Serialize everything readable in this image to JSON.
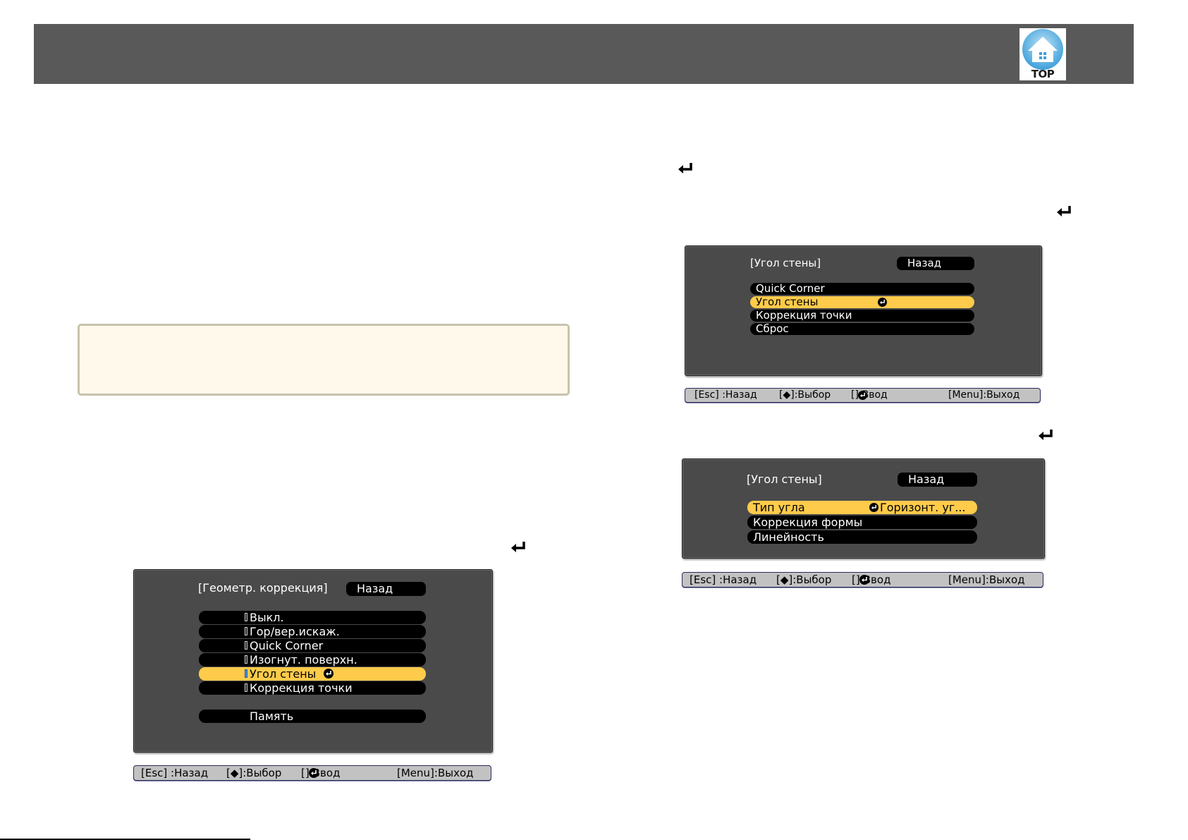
{
  "header": {
    "top_label": "TOP"
  },
  "osd_left": {
    "title": "[Геометр. коррекция]",
    "back": "Назад",
    "items": [
      {
        "label": "Выкл.",
        "selected": false
      },
      {
        "label": "Гор/вер.искаж.",
        "selected": false
      },
      {
        "label": "Quick Corner",
        "selected": false
      },
      {
        "label": "Изогнут. поверхн.",
        "selected": false
      },
      {
        "label": "Угол стены",
        "selected": true
      },
      {
        "label": "Коррекция точки",
        "selected": false
      }
    ],
    "memory": "Память"
  },
  "osd_top_right": {
    "title": "[Угол стены]",
    "back": "Назад",
    "items": [
      {
        "label": "Quick Corner",
        "selected": false
      },
      {
        "label": "Угол стены",
        "selected": true
      },
      {
        "label": "Коррекция точки",
        "selected": false
      },
      {
        "label": "Сброс",
        "selected": false
      }
    ]
  },
  "osd_bottom_right": {
    "title": "[Угол стены]",
    "back": "Назад",
    "items": [
      {
        "label": "Тип угла",
        "value": "Горизонт. уг...",
        "selected": true
      },
      {
        "label": "Коррекция формы",
        "value": "",
        "selected": false
      },
      {
        "label": "Линейность",
        "value": "",
        "selected": false
      }
    ]
  },
  "helpbar": {
    "esc": "[Esc] :Назад",
    "select": "[◆]:Выбор",
    "enter": "[]:Ввод",
    "menu": "[Menu]:Выход"
  },
  "colors": {
    "header": "#595959",
    "osd_bg": "#4a4a4a",
    "selected": "#fecb4a",
    "note_bg": "#fef9ea",
    "note_border": "#c9c2ac",
    "helpbar_bg": "#c2c2c2"
  }
}
